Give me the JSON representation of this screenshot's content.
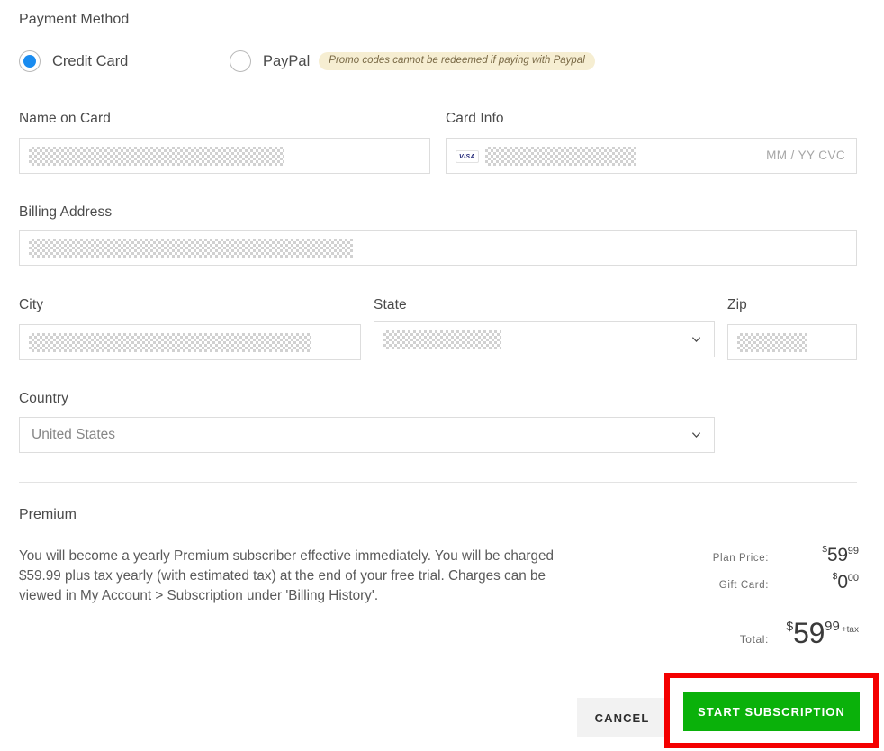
{
  "payment_method": {
    "section_label": "Payment Method",
    "options": [
      {
        "label": "Credit Card",
        "selected": true
      },
      {
        "label": "PayPal",
        "selected": false
      }
    ],
    "paypal_notice": "Promo codes cannot be redeemed if paying with Paypal",
    "selected_color": "#1a8cf0",
    "notice_bg": "#f6eed2"
  },
  "form": {
    "name_on_card": {
      "label": "Name on Card",
      "value": ""
    },
    "card_info": {
      "label": "Card Info",
      "brand_icon": "visa-logo-icon",
      "brand_text": "VISA",
      "value": "",
      "hint": "MM / YY  CVC"
    },
    "billing_address": {
      "label": "Billing Address",
      "value": ""
    },
    "city": {
      "label": "City",
      "value": ""
    },
    "state": {
      "label": "State",
      "value": ""
    },
    "zip": {
      "label": "Zip",
      "value": ""
    },
    "country": {
      "label": "Country",
      "value": "United States"
    }
  },
  "plan": {
    "name": "Premium",
    "description": "You will become a yearly Premium subscriber effective immediately. You will be charged $59.99 plus tax yearly (with estimated tax) at the end of your free trial. Charges can be viewed in My Account > Subscription under 'Billing History'."
  },
  "summary": {
    "plan_price": {
      "label": "Plan Price:",
      "currency": "$",
      "whole": "59",
      "cents": "99"
    },
    "gift_card": {
      "label": "Gift Card:",
      "currency": "$",
      "whole": "0",
      "cents": "00"
    },
    "total": {
      "label": "Total:",
      "currency": "$",
      "whole": "59",
      "cents": "99",
      "tax_note": "+tax"
    }
  },
  "footer": {
    "cancel_label": "CANCEL",
    "start_label": "START SUBSCRIPTION",
    "start_button_color": "#0ab10a",
    "highlight_color": "#f40000"
  }
}
